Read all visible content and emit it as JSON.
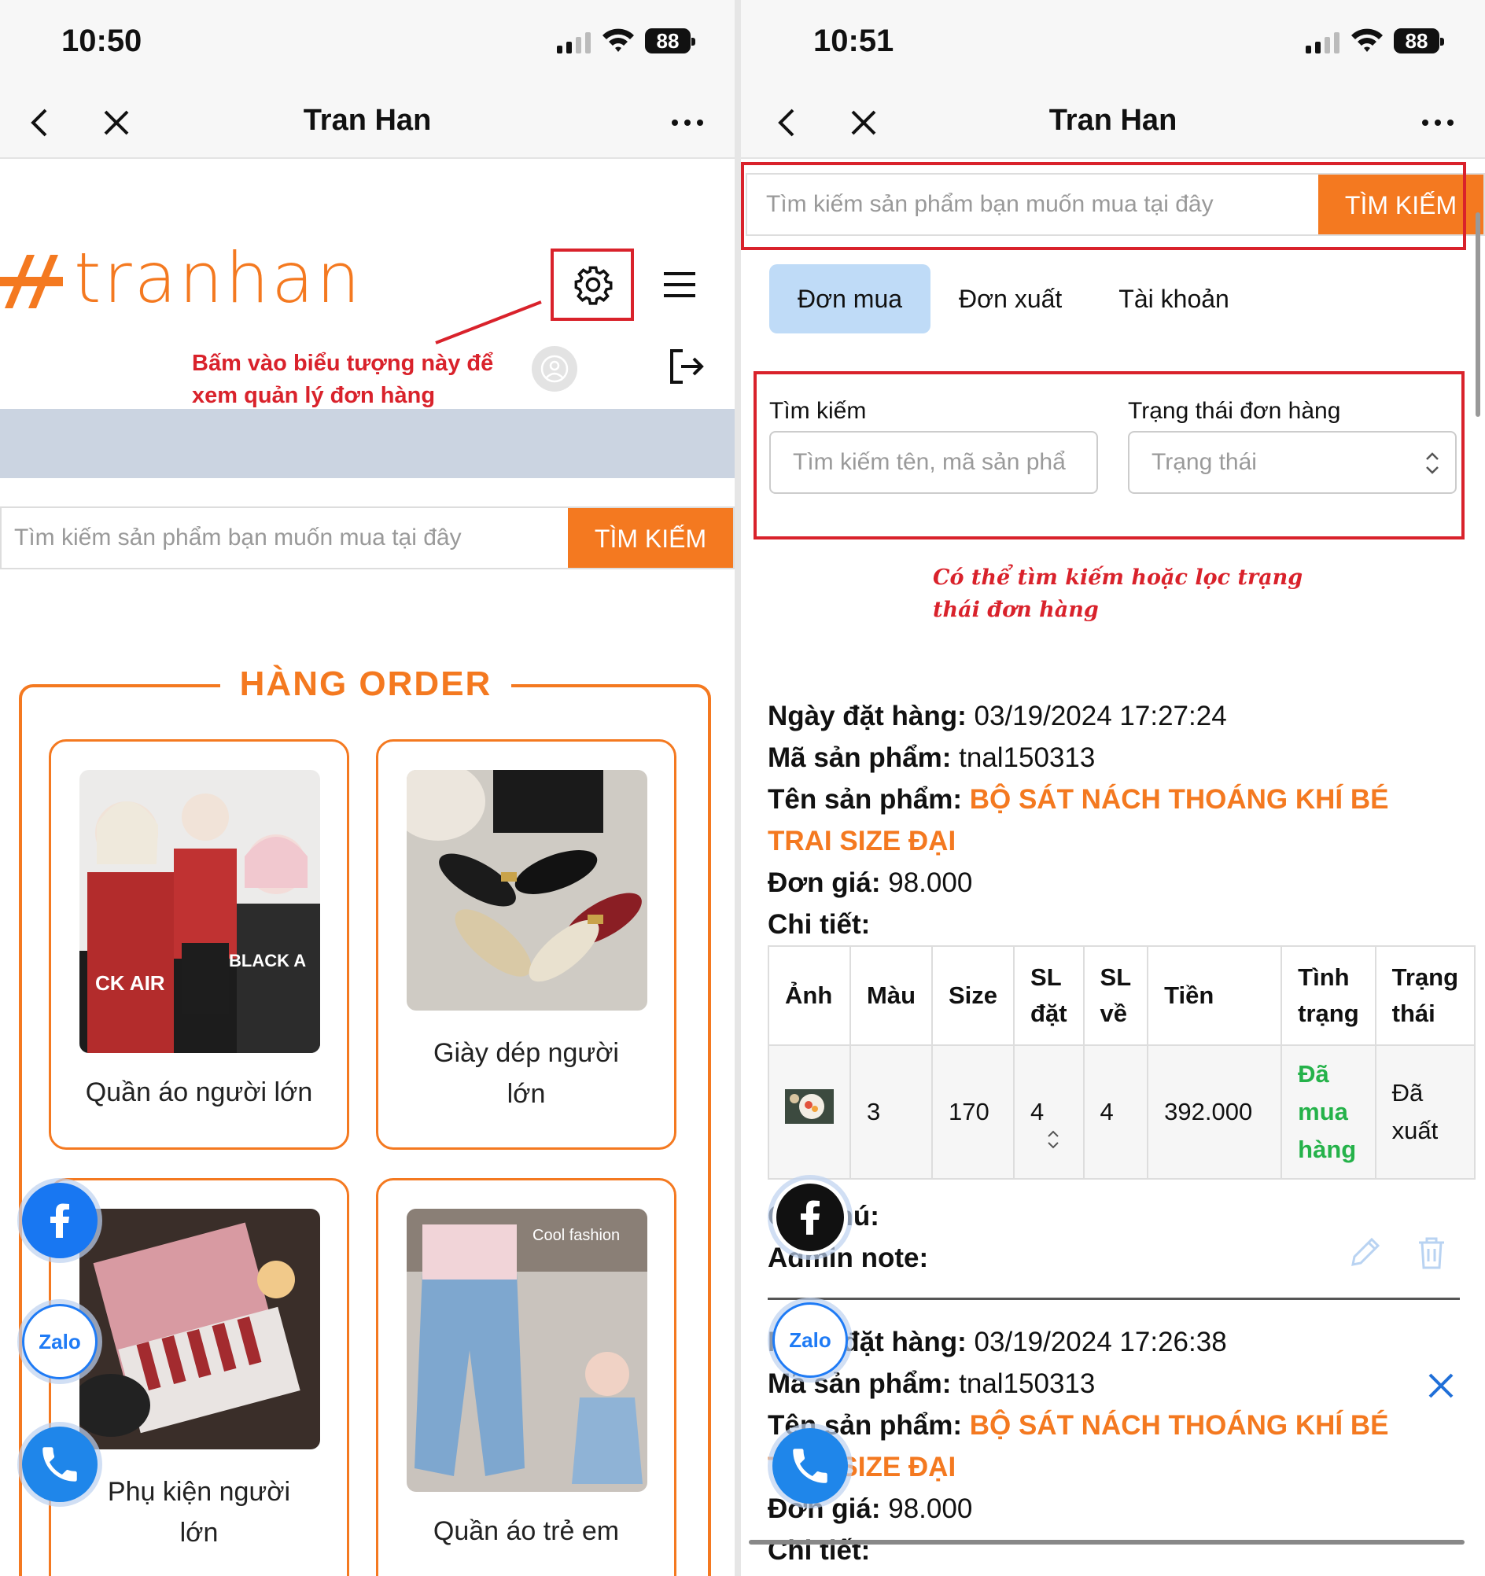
{
  "left": {
    "status": {
      "time": "10:50",
      "battery": "88"
    },
    "nav": {
      "title": "Tran Han"
    },
    "logo_text": "tranhan",
    "annotation": [
      "Bấm vào biểu tượng này để",
      "xem quản lý đơn hàng"
    ],
    "search": {
      "placeholder": "Tìm kiếm sản phẩm bạn muốn mua tại đây",
      "button": "TÌM KIẾM"
    },
    "section_title": "HÀNG ORDER",
    "categories": [
      {
        "label": "Quần áo người lớn"
      },
      {
        "label1": "Giày dép người",
        "label2": "lớn"
      },
      {
        "label1": "Phụ kiện người",
        "label2": "lớn"
      },
      {
        "label": "Quần áo trẻ em"
      }
    ],
    "zalo_label": "Zalo"
  },
  "right": {
    "status": {
      "time": "10:51",
      "battery": "88"
    },
    "nav": {
      "title": "Tran Han"
    },
    "search": {
      "placeholder": "Tìm kiếm sản phẩm bạn muốn mua tại đây",
      "button": "TÌM KIẾM"
    },
    "tabs": [
      "Đơn mua",
      "Đơn xuất",
      "Tài khoản"
    ],
    "filter": {
      "search_label": "Tìm kiếm",
      "search_placeholder": "Tìm kiếm tên, mã sản phẩ",
      "status_label": "Trạng thái đơn hàng",
      "status_placeholder": "Trạng thái"
    },
    "annotation": [
      "Có thể tìm kiếm hoặc lọc trạng",
      "thái đơn hàng"
    ],
    "order1": {
      "date_label": "Ngày đặt hàng:",
      "date": "03/19/2024 17:27:24",
      "code_label": "Mã sản phẩm:",
      "code": "tnal150313",
      "name_label": "Tên sản phẩm:",
      "name1": "BỘ SÁT NÁCH THOÁNG KHÍ BÉ",
      "name2": "TRAI SIZE ĐẠI",
      "price_label": "Đơn giá:",
      "price": "98.000",
      "detail_label": "Chi tiết:",
      "note_label": "Ghi chú:",
      "admin_note_label": "Admin note:"
    },
    "table": {
      "headers": [
        "Ảnh",
        "Màu",
        "Size",
        "SL",
        "đặt",
        "SL",
        "về",
        "Tiền",
        "Tình",
        "trạng",
        "Trạng",
        "thái"
      ],
      "row": {
        "color": "3",
        "size": "170",
        "qty_order": "4",
        "qty_recv": "4",
        "amount": "392.000",
        "cond1": "Đã",
        "cond2": "mua",
        "cond3": "hàng",
        "state1": "Đã",
        "state2": "xuất"
      }
    },
    "order2": {
      "date_label": "Ngày đặt hàng:",
      "date": "03/19/2024 17:26:38",
      "code_label": "Mã sản phẩm:",
      "code": "tnal150313",
      "name_label": "Tên sản phẩm:",
      "name1": "BỘ SÁT NÁCH THOÁNG KHÍ BÉ",
      "name2": "TRAI SIZE ĐẠI",
      "price_label": "Đơn giá:",
      "price": "98.000",
      "detail_label": "Chi tiết:"
    },
    "zalo_label": "Zalo"
  },
  "colors": {
    "accent": "#f47920",
    "annotation": "#d9222b",
    "tab_active": "#bfdbf7",
    "status_green": "#25b24a",
    "edit_icon": "#b9d3f2"
  }
}
